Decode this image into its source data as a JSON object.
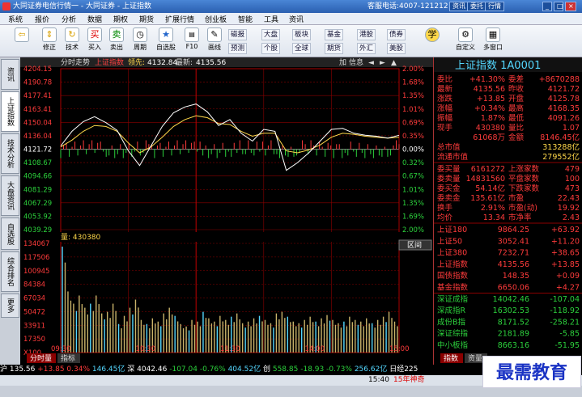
{
  "title_bar": {
    "title": "大同证券电信行情一 - 大同证券 - 上证指数",
    "hotline": "客服电话:4007-121212",
    "buttons": [
      "资讯",
      "委托",
      "行情"
    ]
  },
  "menu": [
    "系统",
    "报价",
    "分析",
    "数据",
    "期权",
    "期货",
    "扩展行情",
    "创业板",
    "智能",
    "工具",
    "资讯"
  ],
  "toolbar": {
    "buttons": [
      {
        "label": "",
        "icon": "back-arrow-icon"
      },
      {
        "label": "修正",
        "icon": "up-down-icon"
      },
      {
        "label": "技术",
        "icon": "refresh-icon"
      },
      {
        "label": "买入",
        "icon": "buy-icon"
      },
      {
        "label": "卖出",
        "icon": "sell-icon"
      },
      {
        "label": "周期",
        "icon": "clock-icon"
      },
      {
        "label": "自选股",
        "icon": "star-icon"
      },
      {
        "label": "F10",
        "icon": "f10-icon"
      },
      {
        "label": "画线",
        "icon": "draw-icon"
      },
      {
        "label": "自定义",
        "icon": "custom-icon"
      },
      {
        "label": "多窗口",
        "icon": "window-icon"
      }
    ],
    "dropdowns_top": [
      "磁报",
      "大盘",
      "板块",
      "基金",
      "港股",
      "债券"
    ],
    "dropdowns_bottom": [
      "预测",
      "个股",
      "全球",
      "期货",
      "外汇",
      "美股"
    ]
  },
  "left_tabs": [
    "资讯",
    "上证指数",
    "技术分析",
    "大盘资讯",
    "自选股",
    "综合排名",
    "更多"
  ],
  "chart_header": {
    "title": "分时走势",
    "index_name": "上证指数",
    "prev_label": "领先:",
    "prev_value": "4132.84",
    "latest_label": "最新:",
    "latest_value": "4135.56",
    "right_buttons": [
      "加",
      "信息"
    ]
  },
  "price_axis": [
    "4204.15",
    "4190.78",
    "4177.41",
    "4163.41",
    "4150.04",
    "4136.04",
    "4121.72",
    "4108.67",
    "4094.66",
    "4081.29",
    "4067.29",
    "4053.92",
    "4039.29"
  ],
  "pct_axis": [
    "2.00%",
    "1.68%",
    "1.35%",
    "1.01%",
    "0.69%",
    "0.35%",
    "0.00%",
    "0.32%",
    "0.67%",
    "1.01%",
    "1.35%",
    "1.69%",
    "2.00%"
  ],
  "volume_label": "量: 430380",
  "volume_axis": [
    "134067",
    "117506",
    "100945",
    "84384",
    "67034",
    "50472",
    "33911",
    "17350",
    "X100"
  ],
  "time_axis": [
    "09:30",
    "10:30",
    "11:30",
    "14:00",
    "15:00"
  ],
  "bottom_tabs": [
    "分时量",
    "指标"
  ],
  "volume_right_label": "区间",
  "info": {
    "title": "上证指数 1A0001",
    "rows": [
      [
        "委比",
        "+41.30%",
        "委差",
        "+8670288"
      ],
      [
        "最新",
        "4135.56",
        "昨收",
        "4121.72"
      ],
      [
        "涨跌",
        "+13.85",
        "开盘",
        "4125.78"
      ],
      [
        "涨幅",
        "+0.34%",
        "最高",
        "4168.35"
      ],
      [
        "振幅",
        "1.87%",
        "最低",
        "4091.26"
      ],
      [
        "现手",
        "430380",
        "量比",
        "1.07"
      ],
      [
        "",
        "61068万",
        "金额",
        "8146.45亿"
      ]
    ],
    "single_rows": [
      [
        "总市值",
        "313288亿"
      ],
      [
        "流通市值",
        "279552亿"
      ]
    ],
    "rows2": [
      [
        "委买量",
        "6161272",
        "上涨家数",
        "479"
      ],
      [
        "委卖量",
        "14831560",
        "平盘家数",
        "100"
      ],
      [
        "委买金",
        "54.14亿",
        "下跌家数",
        "473"
      ],
      [
        "委卖金",
        "135.61亿",
        "市盈",
        "22.43"
      ],
      [
        "换手",
        "2.91%",
        "市盈(动)",
        "19.92"
      ],
      [
        "均价",
        "13.34",
        "市净率",
        "2.43"
      ]
    ],
    "indices": [
      [
        "上证180",
        "9864.25",
        "+63.92"
      ],
      [
        "上证50",
        "3052.41",
        "+11.20"
      ],
      [
        "上证380",
        "7232.71",
        "+38.65"
      ],
      [
        "上证指数",
        "4135.56",
        "+13.85"
      ],
      [
        "国债指数",
        "148.35",
        "+0.09"
      ],
      [
        "基金指数",
        "6650.06",
        "+4.27"
      ],
      [
        "深证成指",
        "14042.46",
        "-107.04"
      ],
      [
        "深成指R",
        "16302.53",
        "-118.92"
      ],
      [
        "成份B指",
        "8171.52",
        "-258.21"
      ],
      [
        "深证综指",
        "2181.89",
        "-5.85"
      ],
      [
        "中小板指",
        "8663.16",
        "-51.95"
      ]
    ],
    "tabs": [
      "指数",
      "资量"
    ]
  },
  "ticker": [
    "沪 135.56",
    "+13.85",
    "0.34%",
    "146.45亿",
    "深 4042.46",
    "-107.04",
    "-0.76%",
    "404.52亿",
    "创",
    "558.85",
    "-18.93",
    "-0.73%",
    "256.62亿",
    "日经225"
  ],
  "status": {
    "time": "15:40",
    "message": "15年神奇"
  },
  "watermark": "最需教育",
  "colors": {
    "up": "#ff3b3b",
    "down": "#2cd13c",
    "grid": "#8b0000",
    "price_line": "#ffffff",
    "avg_line": "#ffd84a",
    "volume": "#c9b36a"
  },
  "chart_data": {
    "type": "line",
    "x": [
      "09:30",
      "10:30",
      "11:30",
      "14:00",
      "15:00"
    ],
    "series": [
      {
        "name": "上证指数",
        "values": [
          4125,
          4140,
          4150,
          4155,
          4149,
          4141,
          4120,
          4105,
          4125,
          4145,
          4159,
          4165,
          4168,
          4160,
          4146,
          4152,
          4138,
          4130,
          4142,
          4140,
          4100,
          4108,
          4118,
          4130,
          4142,
          4143,
          4138,
          4136,
          4135,
          4133,
          4136
        ]
      },
      {
        "name": "均价",
        "values": [
          4124,
          4131,
          4140,
          4146,
          4145,
          4140,
          4128,
          4118,
          4124,
          4134,
          4145,
          4152,
          4156,
          4154,
          4148,
          4147,
          4140,
          4135,
          4138,
          4138,
          4120,
          4118,
          4121,
          4126,
          4134,
          4138,
          4137,
          4135,
          4134,
          4133,
          4134
        ]
      }
    ],
    "volume": [
      130,
      75,
      60,
      70,
      55,
      60,
      70,
      48,
      50,
      60,
      35,
      45,
      55,
      65,
      40,
      35,
      42,
      38,
      48,
      55,
      45,
      35,
      32,
      40,
      38,
      50,
      42,
      38,
      45,
      40,
      44,
      48,
      36,
      38,
      42,
      45,
      40,
      36,
      48,
      50,
      44,
      38,
      36,
      40,
      44,
      38,
      42,
      46,
      40,
      36,
      38,
      44,
      40,
      38,
      42,
      36,
      40,
      44,
      50,
      38
    ],
    "ylim": [
      4039.29,
      4204.15
    ]
  }
}
